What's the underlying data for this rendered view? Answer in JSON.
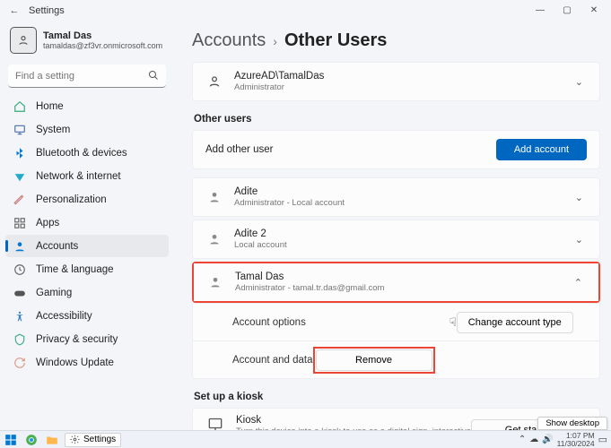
{
  "titlebar": {
    "title": "Settings"
  },
  "profile": {
    "name": "Tamal Das",
    "email": "tamaldas@zf3vr.onmicrosoft.com"
  },
  "search": {
    "placeholder": "Find a setting"
  },
  "nav": {
    "home": "Home",
    "system": "System",
    "bluetooth": "Bluetooth & devices",
    "network": "Network & internet",
    "personalization": "Personalization",
    "apps": "Apps",
    "accounts": "Accounts",
    "time": "Time & language",
    "gaming": "Gaming",
    "accessibility": "Accessibility",
    "privacy": "Privacy & security",
    "update": "Windows Update"
  },
  "breadcrumb": {
    "parent": "Accounts",
    "current": "Other Users"
  },
  "owner": {
    "title": "AzureAD\\TamalDas",
    "sub": "Administrator"
  },
  "section1": "Other users",
  "addrow": {
    "label": "Add other user",
    "button": "Add account"
  },
  "u1": {
    "name": "Adite",
    "sub": "Administrator - Local account"
  },
  "u2": {
    "name": "Adite 2",
    "sub": "Local account"
  },
  "u3": {
    "name": "Tamal Das",
    "sub": "Administrator - tamal.tr.das@gmail.com"
  },
  "opt": {
    "label": "Account options",
    "button": "Change account type"
  },
  "dat": {
    "label": "Account and data",
    "button": "Remove"
  },
  "section2": "Set up a kiosk",
  "kiosk": {
    "title": "Kiosk",
    "sub": "Turn this device into a kiosk to use as a digital sign, interactive display, or other things",
    "button": "Get started"
  },
  "toast": "Show desktop",
  "taskbar": {
    "app": "Settings",
    "time": "1:07 PM",
    "date": "11/30/2024"
  }
}
